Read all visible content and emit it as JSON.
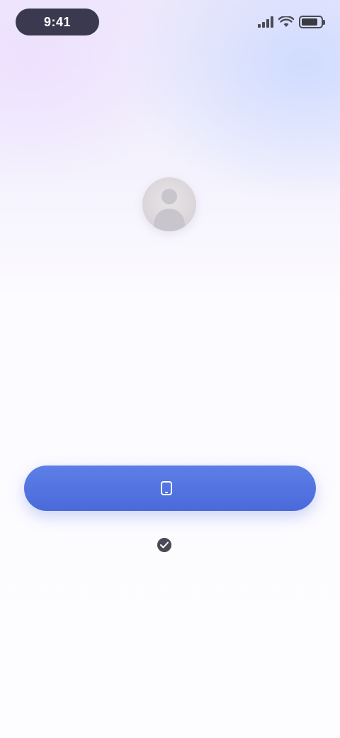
{
  "status_bar": {
    "time": "9:41",
    "battery_level": 0.85
  },
  "profile": {
    "name": "",
    "description": ""
  },
  "login": {
    "phone_number": "",
    "primary_button_label": "",
    "agreement_prefix": "",
    "agreement_link": "",
    "other_login_label": ""
  },
  "colors": {
    "accent": "#4a6adb",
    "background_top": "#efe9fb",
    "background_bottom": "#fdfcff",
    "status_pill": "#3b3950"
  },
  "icons": [
    "signal-icon",
    "wifi-icon",
    "battery-icon",
    "user-avatar-icon",
    "phone-icon",
    "checkmark-icon"
  ]
}
